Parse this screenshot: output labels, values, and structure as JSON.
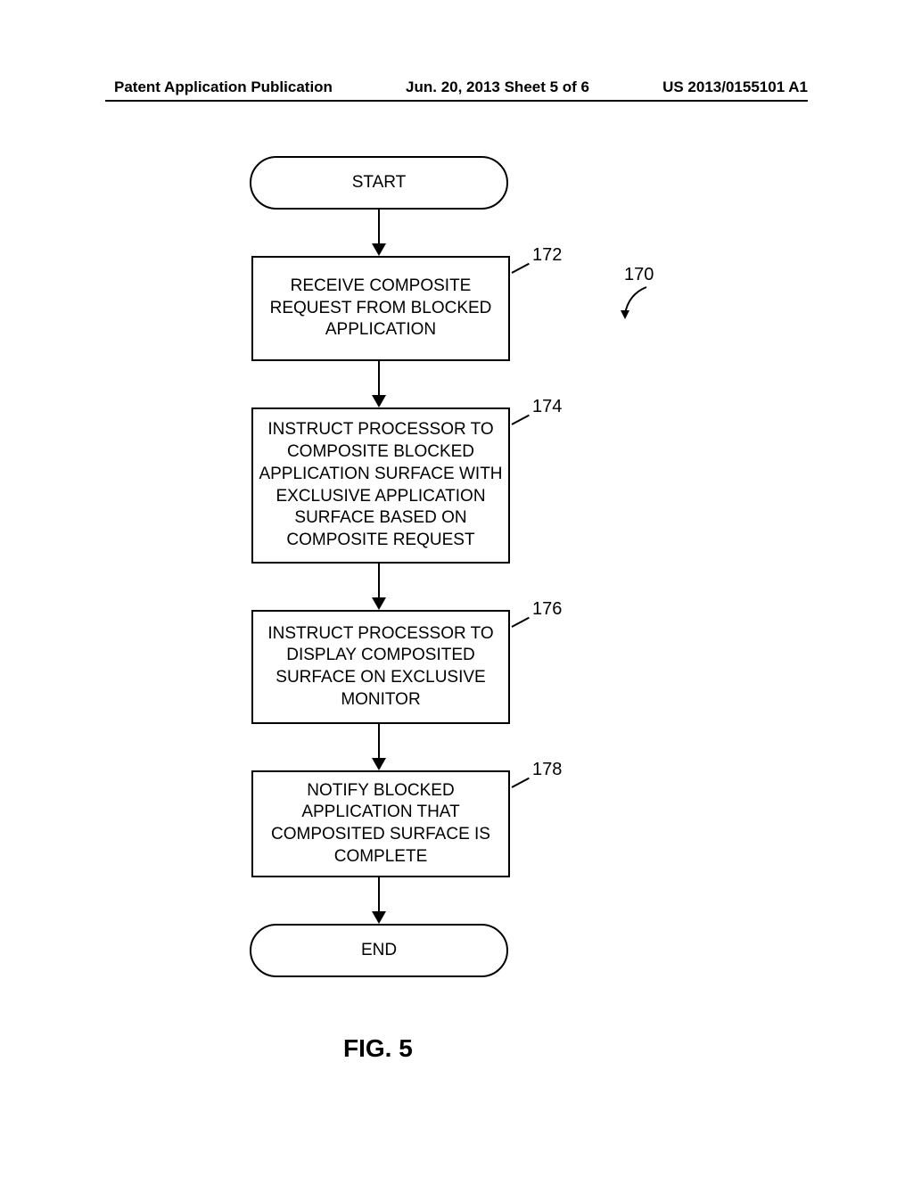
{
  "header": {
    "left": "Patent Application Publication",
    "center": "Jun. 20, 2013  Sheet 5 of 6",
    "right": "US 2013/0155101 A1"
  },
  "flowchart": {
    "start": "START",
    "step_172": "RECEIVE COMPOSITE REQUEST FROM BLOCKED APPLICATION",
    "step_174": "INSTRUCT PROCESSOR TO COMPOSITE BLOCKED APPLICATION SURFACE WITH EXCLUSIVE APPLICATION SURFACE BASED ON COMPOSITE REQUEST",
    "step_176": "INSTRUCT PROCESSOR TO DISPLAY COMPOSITED SURFACE ON EXCLUSIVE MONITOR",
    "step_178": "NOTIFY BLOCKED APPLICATION THAT COMPOSITED SURFACE IS COMPLETE",
    "end": "END"
  },
  "refs": {
    "r170": "170",
    "r172": "172",
    "r174": "174",
    "r176": "176",
    "r178": "178"
  },
  "figure_label": "FIG. 5"
}
